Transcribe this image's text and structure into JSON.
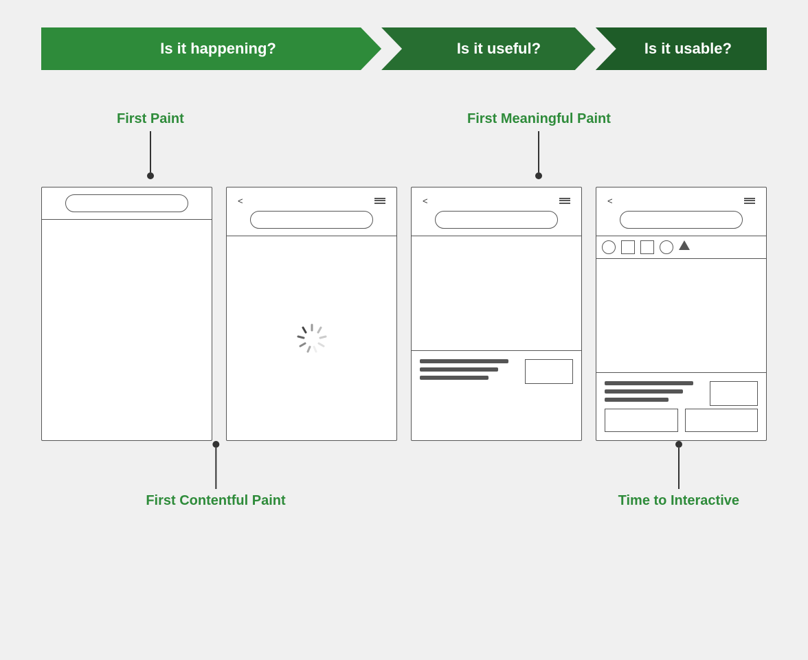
{
  "banner": {
    "label1": "Is it happening?",
    "label2": "Is it useful?",
    "label3": "Is it usable?"
  },
  "labels": {
    "first_paint": "First Paint",
    "first_contentful_paint": "First Contentful Paint",
    "first_meaningful_paint": "First Meaningful Paint",
    "time_to_interactive": "Time to Interactive"
  },
  "screens": {
    "screen1_name": "first-paint-screen",
    "screen2_name": "first-contentful-paint-screen",
    "screen3_name": "first-meaningful-paint-screen",
    "screen4_name": "time-to-interactive-screen"
  }
}
